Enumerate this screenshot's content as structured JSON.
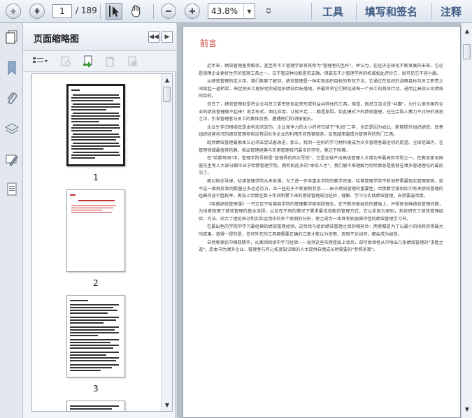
{
  "toolbar": {
    "current_page": "1",
    "total_pages": "/ 189",
    "zoom": "43.8%",
    "tools_label": "工具",
    "sign_label": "填写和签名",
    "comment_label": "注释"
  },
  "panel": {
    "title": "页面缩略图",
    "thumbnails": [
      {
        "number": "1"
      },
      {
        "number": "2"
      },
      {
        "number": "3"
      }
    ]
  },
  "document": {
    "heading": "前言",
    "paragraphs": [
      "近年来，绩效管理备受推崇，甚至有不少管理学家将其称为\"管理者的圣杯\"。并认为，在经济全球化不断发展的未来，它必是保障企业更好生存的管理工具之一。日不管这种论断是否正确，但毫无不少管理学界的权威如此评价它，就可见它不容小觑。",
      "从绩效管理的定义中，我们能够了解到，绩效管理是一种实现组织目标的有效方法，它通过在组织的战略目标与员工职责之间架起一道桥梁，来促使员工更好地完成组织绩效目标落地，并最终将它们转化成每一个员工的具体行动，进而让高效公司绩效的目的。",
      "说白了，绩效管理就是将企业与员工紧密联系起来形成利益共同体的工具。但是，既然立足点是\"共赢\"，为什么很多国内企业的绩效管理做不起来？说手形式、面化应用、认知不足……都是原因。如此模式下的绩效管理，往往会陷入费力不讨好的境地之中，引发管理者与员工的集体反感，遭遇他们的消极抵抗。",
      "企业生存归根结底是由利润决定的，企业竞争力的大小终将归结于\"利润\"二字，也正是因为如此，能够提升组织绩效、改善组织经营状况的绩效管理非但没有因众多企业的利用失败而被抛弃，反而越来越成为管理界的热门工具。",
      "既然绩效管理最根本又必须去尝试着改进，那么，找到一些好的学习材料便成为众多管理者最迫切的愿望。全球范围内，在管理领域最值得信赖、推出管理经典与实用管理技巧最多的学府，莫过于哈佛。",
      "在\"哈佛帝国\"中，管理学院号称是\"管理界的西点军校\"，它是全球产出高级管理人才成功率最高的学院之一。在教育家吴国盛先生等人大部分都毕业于哈佛管理学院，拥有如此多的\"本校人才\"，我们便不难理解为何哈佛总是能够在诸多管理理论的最前沿了。",
      "面对舆论导弹，哈佛管理学院从未自满；为了进一步丰富本学院的教学资源，哈佛管理学院不断地积累最现实管理案例，如今这一案例库案例数量已多达近百万，且一些处于不断更新状态——由于绩效管理的重要性，哈佛教学案例库中有关绩效管理的经典内容不胜枚举，再加上哈佛在数十年间积累下来的绩效管理成功经验，理解、学习与实践绩效管理，自然要选哈佛。",
      "《哈佛绩效管理课》一书立足于哈佛商学院的管理教学案例和理念，在不断探索经验的基础上，并帮助各种绩效管理问题，为读者梳理了绩效管理的基本流程，以及在不同的情况下需求最佳效能的管理方式，它以实用为原则，系统研究了绩效管理经验，方法，综合了理论探讨和实际运用中的多个案例的分析，使之成为一本具有较强操作性的绩效管理学习书。",
      "在最出色的学院中学习最经典的绩效管理经验，这恰恰与组织绩效管理之目的相契合：两者都是为了以最小的损耗获得最大的成果。值得一提的是，任何外在的工具都需要正确的立意才能以为使用，否则不论如何，都会成为枷锁。",
      "自然奥顿论中国取精华，从案例阅读中学习经验——虽然这些依然是纸上谈兵，却可助读者从中悟出几条绩效管理的\"求胜之道\"。愿本书为诸多企业、管理者与有心拓宽知识面的人士提供自我成长所需要的\"参照系数\"。"
    ]
  },
  "colors": {
    "toolbar_text": "#3e5a83",
    "heading": "#c83a2a"
  }
}
